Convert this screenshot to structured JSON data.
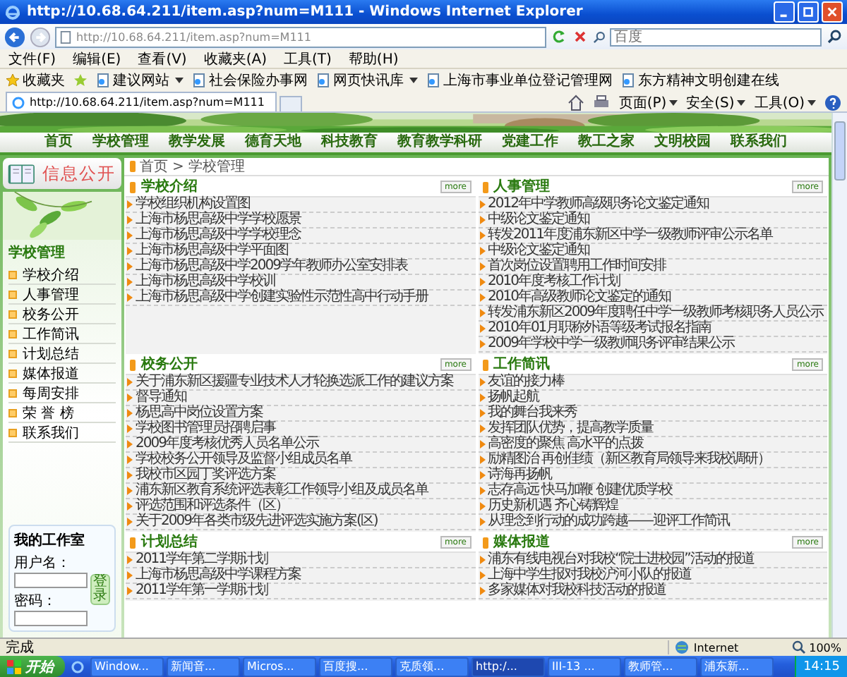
{
  "window": {
    "title": "http://10.68.64.211/item.asp?num=M111 - Windows Internet Explorer"
  },
  "address_bar": {
    "url": "http://10.68.64.211/item.asp?num=M111",
    "search_placeholder": "百度"
  },
  "menu_bar": [
    "文件(F)",
    "编辑(E)",
    "查看(V)",
    "收藏夹(A)",
    "工具(T)",
    "帮助(H)"
  ],
  "favorites_bar": {
    "label": "收藏夹",
    "links": [
      {
        "text": "建议网站",
        "dropdown": true
      },
      {
        "text": "社会保险办事网",
        "dropdown": false
      },
      {
        "text": "网页快讯库",
        "dropdown": true
      },
      {
        "text": "上海市事业单位登记管理网",
        "dropdown": false
      },
      {
        "text": "东方精神文明创建在线",
        "dropdown": false
      }
    ]
  },
  "tabs": [
    {
      "label": "http://10.68.64.211/item.asp?num=M111",
      "selected": true
    }
  ],
  "command_bar": [
    "页面(P)",
    "安全(S)",
    "工具(O)"
  ],
  "nav": [
    "首页",
    "学校管理",
    "教学发展",
    "德育天地",
    "科技教育",
    "教育教学科研",
    "党建工作",
    "教工之家",
    "文明校园",
    "联系我们"
  ],
  "sidebar": {
    "badge": "信息公开",
    "menu_title": "学校管理",
    "items": [
      "学校介绍",
      "人事管理",
      "校务公开",
      "工作简讯",
      "计划总结",
      "媒体报道",
      "每周安排",
      "荣 誉 榜",
      "联系我们"
    ],
    "login": {
      "title": "我的工作室",
      "username_label": "用户名：",
      "password_label": "密码：",
      "button": "登录"
    }
  },
  "breadcrumb": {
    "items": [
      "首页",
      "学校管理"
    ],
    "separator": ">"
  },
  "sections": [
    {
      "title": "学校介绍",
      "more": "more",
      "items": [
        "学校组织机构设置图",
        "上海市杨思高级中学学校愿景",
        "上海市杨思高级中学学校理念",
        "上海市杨思高级中学平面图",
        "上海市杨思高级中学2009学年教师办公室安排表",
        "上海市杨思高级中学校训",
        "上海市杨思高级中学创建实验性示范性高中行动手册"
      ]
    },
    {
      "title": "人事管理",
      "more": "more",
      "items": [
        "2012年中学教师高级职务论文鉴定通知",
        "中级论文鉴定通知",
        "转发2011年度浦东新区中学一级教师评审公示名单",
        "中级论文鉴定通知",
        "首次岗位设置聘用工作时间安排",
        "2010年度考核工作计划",
        "2010年高级教师论文鉴定的通知",
        "转发浦东新区2009年度聘任中学一级教师考核职务人员公示",
        "2010年01月职称外语等级考试报名指南",
        "2009年学校中学一级教师职务评审结果公示"
      ]
    },
    {
      "title": "校务公开",
      "more": "more",
      "items": [
        "关于浦东新区援疆专业技术人才轮换选派工作的建议方案",
        "督导通知",
        "杨思高中岗位设置方案",
        "学校图书管理员招聘启事",
        "2009年度考核优秀人员名单公示",
        "学校校务公开领导及监督小组成员名单",
        "我校市区园丁奖评选方案",
        "浦东新区教育系统评选表彰工作领导小组及成员名单",
        "评选范围和评选条件（区）",
        "关于2009年各类市级先进评选实施方案(区)"
      ]
    },
    {
      "title": "工作简讯",
      "more": "more",
      "items": [
        "友谊的接力棒",
        "扬帆起航",
        "我的舞台我来秀",
        "发挥团队优势，提高教学质量",
        "高密度的聚焦 高水平的点拨",
        "励精图治 再创佳绩（新区教育局领导来我校调研）",
        "诗海再扬帆",
        "志存高远 快马加鞭 创建优质学校",
        "历史新机遇 齐心铸辉煌",
        "从理念到行动的成功跨越——迎评工作简讯"
      ]
    },
    {
      "title": "计划总结",
      "more": "more",
      "items": [
        "2011学年第二学期计划",
        "上海市杨思高级中学课程方案",
        "2011学年第一学期计划"
      ]
    },
    {
      "title": "媒体报道",
      "more": "more",
      "items": [
        "浦东有线电视台对我校“院士进校园”活动的报道",
        "上海中学生报对我校沪河小队的报道",
        "多家媒体对我校科技活动的报道"
      ]
    }
  ],
  "status_bar": {
    "text": "完成",
    "zone": "Internet",
    "zoom": "100%"
  },
  "taskbar": {
    "start": "开始",
    "buttons": [
      {
        "label": "Window...",
        "selected": false
      },
      {
        "label": "新闻音...",
        "selected": false
      },
      {
        "label": "Micros...",
        "selected": false
      },
      {
        "label": "百度搜...",
        "selected": false
      },
      {
        "label": "克质领...",
        "selected": false
      },
      {
        "label": "http:/...",
        "selected": true
      },
      {
        "label": "III-13 ...",
        "selected": false
      },
      {
        "label": "教师管...",
        "selected": false
      },
      {
        "label": "浦东新...",
        "selected": false
      }
    ],
    "clock": "14:15"
  }
}
